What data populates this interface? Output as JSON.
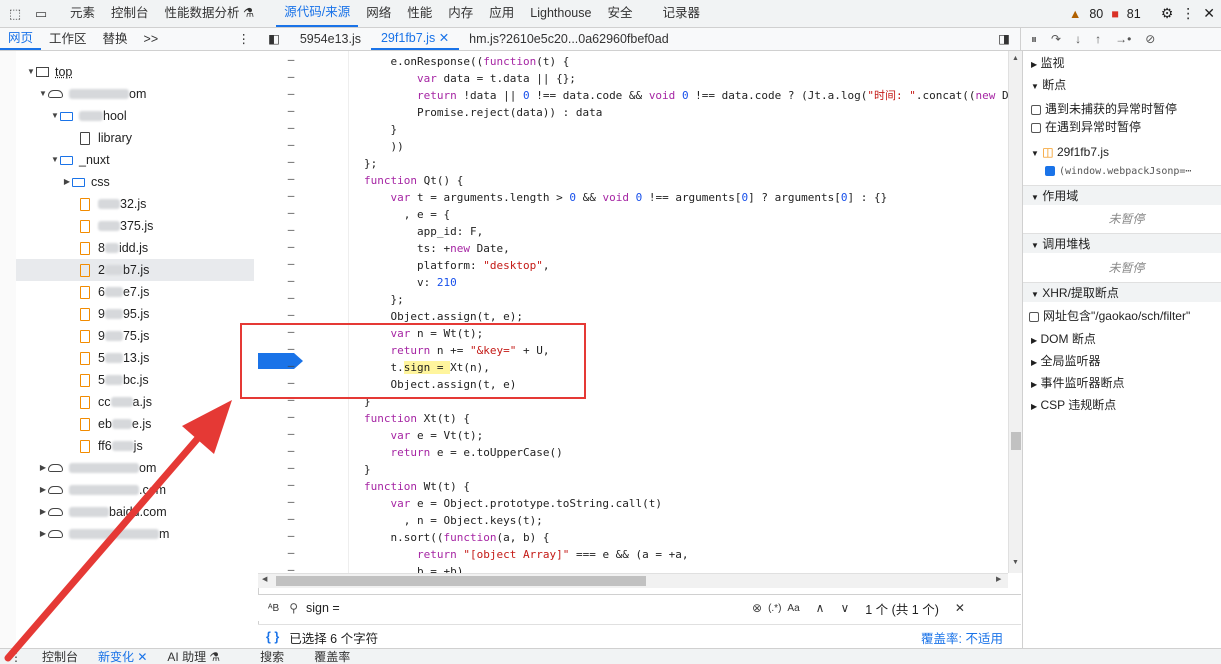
{
  "topbar": {
    "tabs": [
      "元素",
      "控制台",
      "性能数据分析 ⚗",
      "源代码/来源",
      "网络",
      "性能",
      "内存",
      "应用",
      "Lighthouse",
      "安全",
      "记录器"
    ],
    "active_tab": "源代码/来源",
    "warnings": "80",
    "errors": "81"
  },
  "navigator": {
    "tabs": [
      "网页",
      "工作区",
      "替换"
    ],
    "more": ">>",
    "tree": [
      {
        "label": "top",
        "icon": "frame"
      },
      {
        "label": "om",
        "icon": "cloud"
      },
      {
        "label": "hool",
        "icon": "folder"
      },
      {
        "label": "library",
        "icon": "doc"
      },
      {
        "label": "_nuxt",
        "icon": "folder"
      },
      {
        "label": "css",
        "icon": "folder"
      },
      {
        "label": "32.js"
      },
      {
        "label": "375.js"
      },
      {
        "label": "idd.js"
      },
      {
        "label": "2",
        "suffix": "b7.js"
      },
      {
        "label": "6",
        "suffix": "e7.js"
      },
      {
        "label": "9",
        "suffix": "95.js"
      },
      {
        "label": "9",
        "suffix": "75.js"
      },
      {
        "label": "5",
        "suffix": "13.js"
      },
      {
        "label": "5",
        "suffix": "bc.js"
      },
      {
        "label": "cc",
        "suffix": "a.js"
      },
      {
        "label": "eb",
        "suffix": "e.js"
      },
      {
        "label": "ff6",
        "suffix": "js"
      },
      {
        "label": "om",
        "icon": "cloud"
      },
      {
        "label": ".com",
        "icon": "cloud"
      },
      {
        "label": "baidu.com",
        "icon": "cloud"
      },
      {
        "label": "m",
        "icon": "cloud"
      }
    ]
  },
  "filetabs": {
    "tabs": [
      "5954e13.js",
      "29f1fb7.js",
      "hm.js?2610e5c20...0a62960fbef0ad"
    ],
    "active": "29f1fb7.js"
  },
  "code": {
    "lines": [
      "    e.onResponse((function(t) {",
      "        var data = t.data || {};",
      "        return !data || 0 !== data.code && void 0 !== data.code ? (Jt.a.log(\"时间: \".concat((new Date).toLo",
      "        Promise.reject(data)) : data",
      "    }",
      "    ))",
      "};",
      "function Qt() {",
      "    var t = arguments.length > 0 && void 0 !== arguments[0] ? arguments[0] : {}",
      "      , e = {",
      "        app_id: F,",
      "        ts: +new Date,",
      "        platform: \"desktop\",",
      "        v: 210",
      "    };",
      "    Object.assign(t, e);",
      "    var n = Wt(t);",
      "    return n += \"&key=\" + U,",
      "    t.sign = Xt(n),",
      "    Object.assign(t, e)",
      "}",
      "function Xt(t) {",
      "    var e = Vt(t);",
      "    return e = e.toUpperCase()",
      "}",
      "function Wt(t) {",
      "    var e = Object.prototype.toString.call(t)",
      "      , n = Object.keys(t);",
      "    n.sort((function(a, b) {",
      "        return \"[object Array]\" === e && (a = +a,",
      "        b = +b),"
    ]
  },
  "search": {
    "query": "sign =",
    "regex_label": "(.*)",
    "case_label": "Aa",
    "result": "1 个 (共 1 个)"
  },
  "status": {
    "selection": "已选择 6 个字符",
    "coverage": "覆盖率: 不适用"
  },
  "debugger": {
    "watch": "监视",
    "breakpoints": "断点",
    "pause_uncaught": "遇到未捕获的异常时暂停",
    "pause_caught": "在遇到异常时暂停",
    "bp_file": "29f1fb7.js",
    "bp_snippet": "(window.webpackJsonp=⋯",
    "scope": "作用域",
    "not_paused_1": "未暂停",
    "callstack": "调用堆栈",
    "not_paused_2": "未暂停",
    "xhr": "XHR/提取断点",
    "xhr_item": "网址包含\"/gaokao/sch/filter\"",
    "dom": "DOM 断点",
    "global": "全局监听器",
    "event": "事件监听器断点",
    "csp": "CSP 违规断点"
  },
  "drawer": {
    "tabs": [
      "控制台",
      "新变化 ✕",
      "AI 助理 ⚗",
      "搜索",
      "覆盖率"
    ]
  },
  "colors": {
    "accent": "#1a73e8",
    "annotation_red": "#e53935",
    "warning": "#b06000",
    "error": "#d93025"
  }
}
